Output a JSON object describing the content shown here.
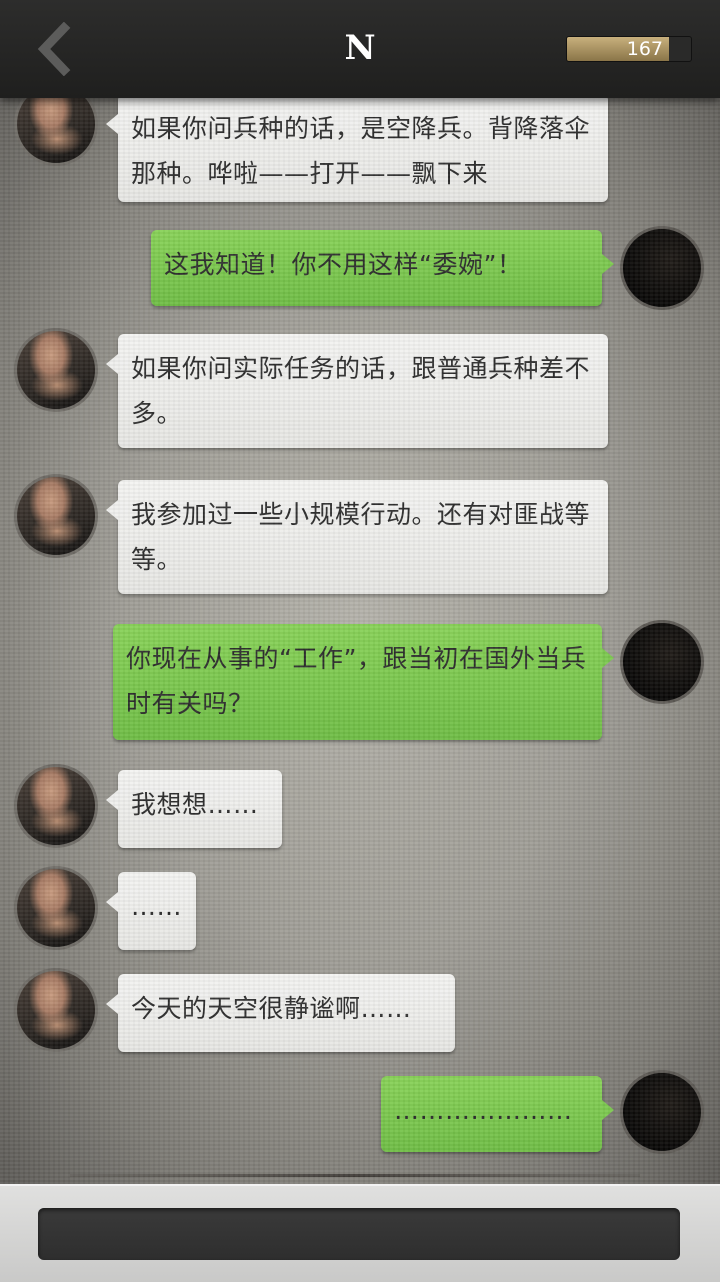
{
  "header": {
    "title": "N",
    "back_icon": "chevron-left-icon",
    "coins_value": "167",
    "coins_fill_fraction": 0.82
  },
  "messages": [
    {
      "sender": "npc",
      "text": "如果你问兵种的话，是空降兵。背降落伞那种。哗啦——打开——飘下来"
    },
    {
      "sender": "me",
      "text": "这我知道！你不用这样“委婉”！"
    },
    {
      "sender": "npc",
      "text": "如果你问实际任务的话，跟普通兵种差不多。"
    },
    {
      "sender": "npc",
      "text": "我参加过一些小规模行动。还有对匪战等等。"
    },
    {
      "sender": "me",
      "text": "你现在从事的“工作”，跟当初在国外当兵时有关吗？"
    },
    {
      "sender": "npc",
      "text": "我想想……"
    },
    {
      "sender": "npc",
      "text": "……"
    },
    {
      "sender": "npc",
      "text": "今天的天空很静谧啊……"
    },
    {
      "sender": "me",
      "text": "…………………"
    }
  ],
  "colors": {
    "outgoing_bubble": "#7cc84f",
    "incoming_bubble": "#efefed",
    "header_bg": "#262625",
    "coin_bar": "#a88f5e"
  }
}
